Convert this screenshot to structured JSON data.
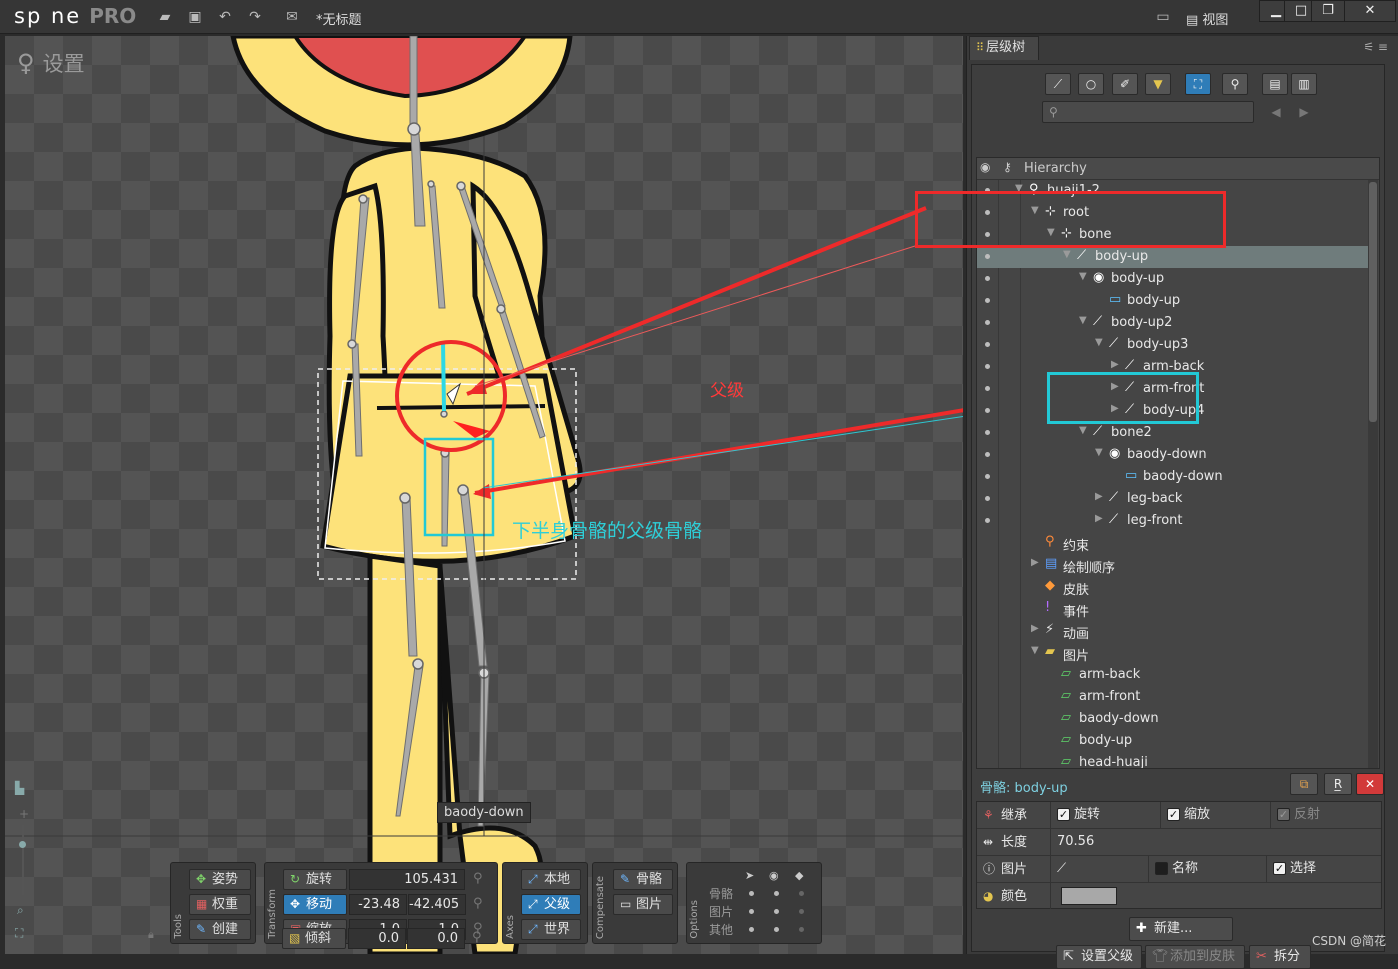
{
  "titlebar": {
    "logo": "sp ne",
    "logo_pro": "PRO",
    "document_title": "*无标题",
    "view_label": "视图",
    "icons": [
      "folder-open-icon",
      "save-icon",
      "undo-icon",
      "redo-icon",
      "mail-icon"
    ]
  },
  "viewport": {
    "mode_label": "设置",
    "annotation_parent": "父级",
    "annotation_lower": "下半身骨骼的父级骨骼",
    "tooltip": "baody-down"
  },
  "tools": {
    "group_label": "Tools",
    "pose": "姿势",
    "weights": "权重",
    "create": "创建"
  },
  "transform": {
    "group_label": "Transform",
    "rotate_label": "旋转",
    "rotate_value": "105.431",
    "translate_label": "移动",
    "translate_x": "-23.48",
    "translate_y": "-42.405",
    "scale_label": "缩放",
    "scale_x": "1.0",
    "scale_y": "1.0",
    "shear_label": "倾斜",
    "shear_x": "0.0",
    "shear_y": "0.0"
  },
  "axes": {
    "group_label": "Axes",
    "local": "本地",
    "parent": "父级",
    "world": "世界"
  },
  "compensate": {
    "group_label": "Compensate",
    "bones": "骨骼",
    "images": "图片"
  },
  "options": {
    "group_label": "Options",
    "rows": [
      "骨骼",
      "图片",
      "其他"
    ]
  },
  "panel": {
    "tab_label": "层级树",
    "search_placeholder": "",
    "tree_header": "Hierarchy",
    "tree": [
      {
        "label": "huaji1-2",
        "icon": "skeleton-icon",
        "depth": 0,
        "arrow": "▼"
      },
      {
        "label": "root",
        "icon": "root-icon",
        "depth": 1,
        "arrow": "▼"
      },
      {
        "label": "bone",
        "icon": "bone-root-icon",
        "depth": 2,
        "arrow": "▼"
      },
      {
        "label": "body-up",
        "icon": "bone-icon",
        "depth": 3,
        "arrow": "▼",
        "selected": true
      },
      {
        "label": "body-up",
        "icon": "slot-icon",
        "depth": 4,
        "arrow": "▼"
      },
      {
        "label": "body-up",
        "icon": "image-attachment-icon",
        "depth": 5,
        "arrow": ""
      },
      {
        "label": "body-up2",
        "icon": "bone-icon",
        "depth": 4,
        "arrow": "▼"
      },
      {
        "label": "body-up3",
        "icon": "bone-icon",
        "depth": 5,
        "arrow": "▼"
      },
      {
        "label": "arm-back",
        "icon": "bone-icon",
        "depth": 6,
        "arrow": "▶"
      },
      {
        "label": "arm-front",
        "icon": "bone-icon",
        "depth": 6,
        "arrow": "▶"
      },
      {
        "label": "body-up4",
        "icon": "bone-icon",
        "depth": 6,
        "arrow": "▶"
      },
      {
        "label": "bone2",
        "icon": "bone-icon",
        "depth": 4,
        "arrow": "▼"
      },
      {
        "label": "baody-down",
        "icon": "slot-icon",
        "depth": 5,
        "arrow": "▼"
      },
      {
        "label": "baody-down",
        "icon": "image-attachment-icon",
        "depth": 6,
        "arrow": ""
      },
      {
        "label": "leg-back",
        "icon": "bone-icon",
        "depth": 5,
        "arrow": "▶"
      },
      {
        "label": "leg-front",
        "icon": "bone-icon",
        "depth": 5,
        "arrow": "▶"
      },
      {
        "label": "约束",
        "icon": "constraint-icon",
        "depth": 1,
        "arrow": ""
      },
      {
        "label": "绘制顺序",
        "icon": "draw-order-icon",
        "depth": 1,
        "arrow": "▶"
      },
      {
        "label": "皮肤",
        "icon": "skins-icon",
        "depth": 1,
        "arrow": ""
      },
      {
        "label": "事件",
        "icon": "events-icon",
        "depth": 1,
        "arrow": ""
      },
      {
        "label": "动画",
        "icon": "animations-icon",
        "depth": 1,
        "arrow": "▶"
      },
      {
        "label": "图片",
        "icon": "images-folder-icon",
        "depth": 1,
        "arrow": "▼"
      },
      {
        "label": "arm-back",
        "icon": "image-file-icon",
        "depth": 2,
        "arrow": ""
      },
      {
        "label": "arm-front",
        "icon": "image-file-icon",
        "depth": 2,
        "arrow": ""
      },
      {
        "label": "baody-down",
        "icon": "image-file-icon",
        "depth": 2,
        "arrow": ""
      },
      {
        "label": "body-up",
        "icon": "image-file-icon",
        "depth": 2,
        "arrow": ""
      },
      {
        "label": "head-huaji",
        "icon": "image-file-icon",
        "depth": 2,
        "arrow": ""
      }
    ]
  },
  "properties": {
    "title": "骨骼: body-up",
    "inherit_label": "继承",
    "rotation_label": "旋转",
    "scale_label": "缩放",
    "reflect_label": "反射",
    "length_label": "长度",
    "length_value": "70.56",
    "image_label": "图片",
    "name_label": "名称",
    "select_label": "选择",
    "color_label": "颜色",
    "color_value": "#a8a8a8",
    "new_button": "新建...",
    "set_parent_button": "设置父级",
    "add_to_skin_button": "添加到皮肤",
    "split_button": "拆分"
  },
  "watermark": "CSDN @简花"
}
